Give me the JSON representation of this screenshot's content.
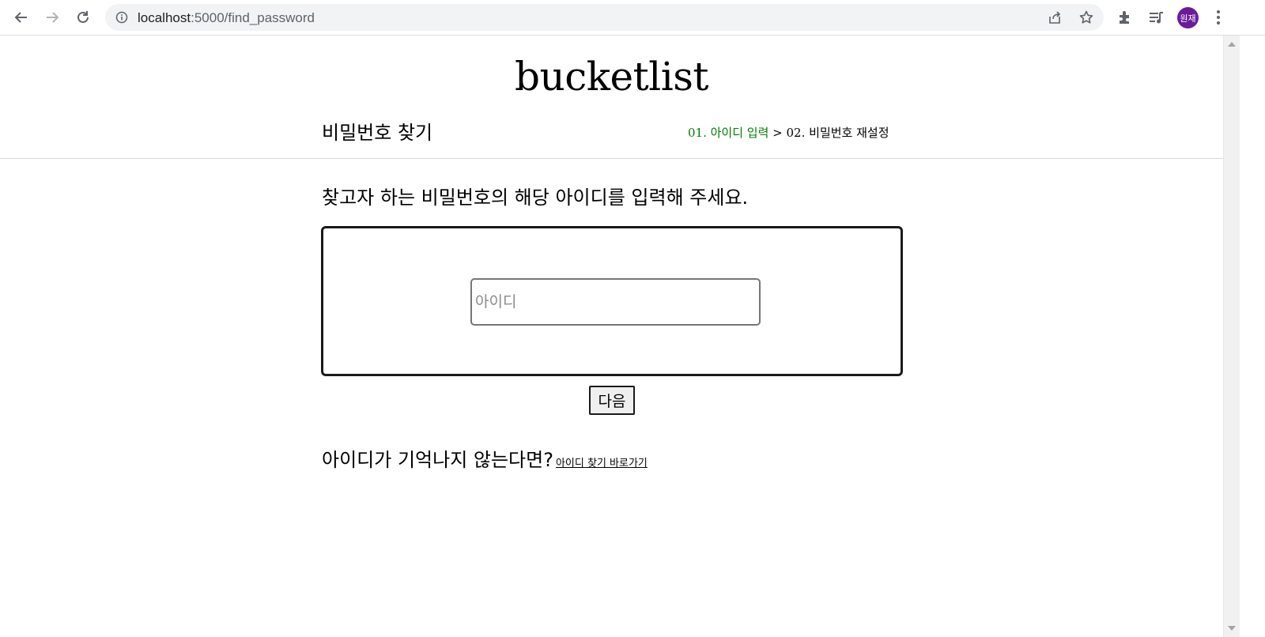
{
  "browser": {
    "url_host": "localhost",
    "url_path": ":5000/find_password",
    "profile_initials": "원재"
  },
  "site": {
    "title": "bucketlist"
  },
  "header": {
    "heading": "비밀번호 찾기",
    "step1": "01. 아이디 입력",
    "separator": " > ",
    "step2": "02. 비밀번호 재설정"
  },
  "main": {
    "instruction": "찾고자 하는 비밀번호의 해당 아이디를 입력해 주세요.",
    "id_placeholder": "아이디",
    "next_label": "다음",
    "help_text": "아이디가 기억나지 않는다면?",
    "help_link": "아이디 찾기 바로가기"
  },
  "colors": {
    "active_step": "#008000",
    "avatar": "#6a1b9a"
  }
}
